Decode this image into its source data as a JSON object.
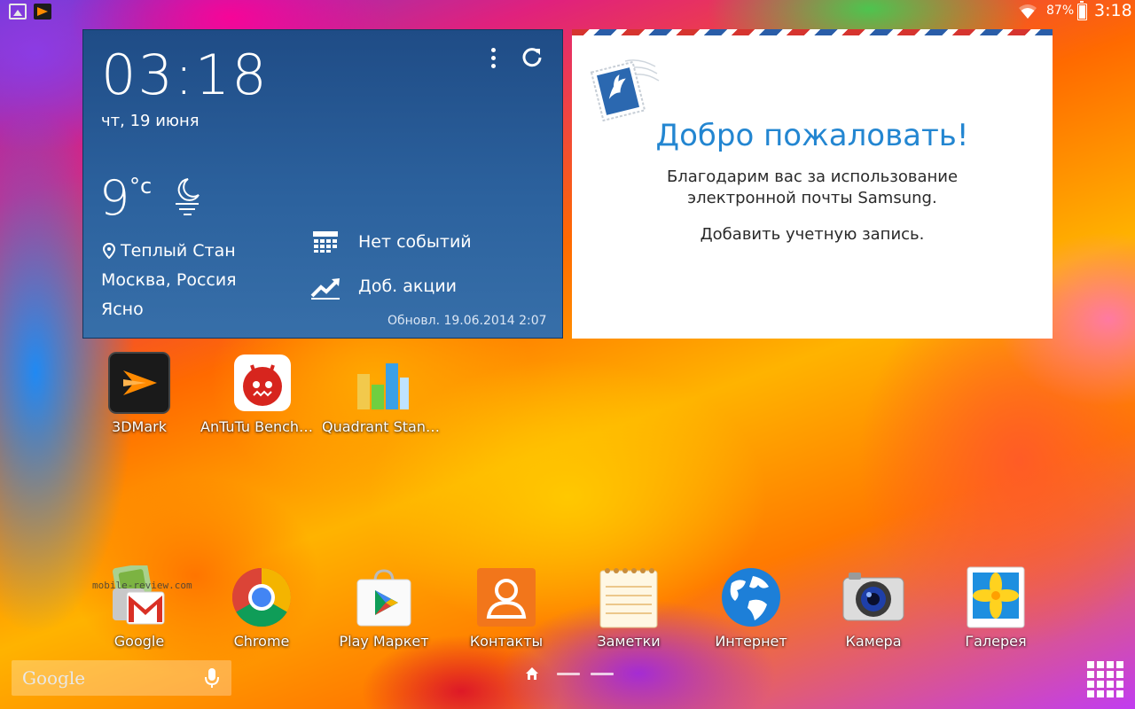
{
  "status_bar": {
    "battery_percent": "87%",
    "battery_level": 0.87,
    "time": "3:18",
    "left_icons": [
      "gallery-icon",
      "3dmark-icon"
    ],
    "right_icons": [
      "wifi-icon",
      "battery-icon"
    ]
  },
  "weather_widget": {
    "time": "03:18",
    "date": "чт, 19 июня",
    "temperature": "9",
    "unit": "°c",
    "location": "Теплый Стан",
    "region": "Москва, Россия",
    "condition": "Ясно",
    "events": "Нет событий",
    "stocks": "Доб. акции",
    "updated": "Обновл. 19.06.2014 2:07",
    "icons": [
      "menu-icon",
      "refresh-icon",
      "moon-icon",
      "location-pin-icon",
      "calendar-icon",
      "stocks-chart-icon"
    ]
  },
  "email_widget": {
    "title": "Добро пожаловать!",
    "message_line1": "Благодарим вас за использование",
    "message_line2": "электронной почты Samsung.",
    "add_account": "Добавить учетную запись.",
    "accent_color": "#2386d1"
  },
  "apps": [
    {
      "label": "3DMark",
      "icon": "3dmark-icon"
    },
    {
      "label": "AnTuTu Benchmark",
      "icon": "antutu-icon"
    },
    {
      "label": "Quadrant Standard",
      "icon": "quadrant-icon"
    }
  ],
  "dock": [
    {
      "label": "Google",
      "icon": "google-folder-icon"
    },
    {
      "label": "Chrome",
      "icon": "chrome-icon"
    },
    {
      "label": "Play Маркет",
      "icon": "play-store-icon"
    },
    {
      "label": "Контакты",
      "icon": "contacts-icon"
    },
    {
      "label": "Заметки",
      "icon": "notes-icon"
    },
    {
      "label": "Интернет",
      "icon": "internet-icon"
    },
    {
      "label": "Камера",
      "icon": "camera-icon"
    },
    {
      "label": "Галерея",
      "icon": "gallery-icon"
    }
  ],
  "watermark": "mobile-review.com",
  "search": {
    "logo": "Google",
    "mic_icon": "microphone-icon"
  },
  "page_indicator": {
    "current": "home",
    "pages": 3
  },
  "apps_button_icon": "apps-grid-icon"
}
